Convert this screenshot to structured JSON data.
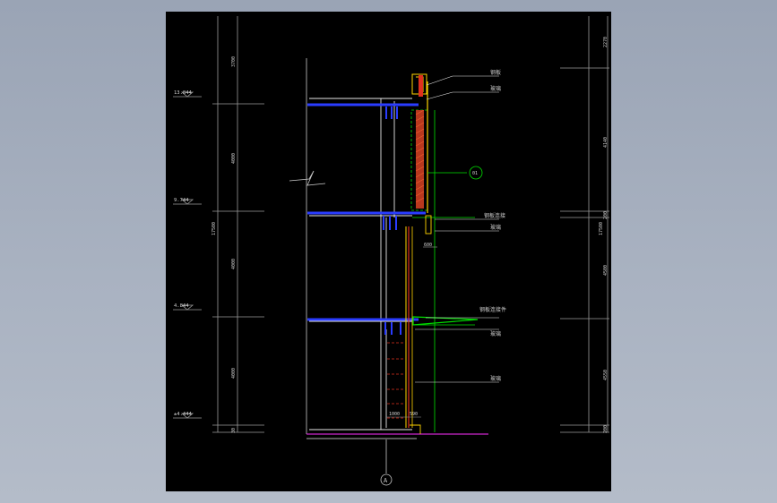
{
  "left_dims": {
    "segments": [
      "3700",
      "4000",
      "4000",
      "4000",
      "30"
    ],
    "levels": [
      "13.844",
      "9.744",
      "4.844",
      "±4.444"
    ]
  },
  "right_dims": {
    "segments": [
      "2270",
      "4140",
      "200",
      "4500",
      "4550",
      "200"
    ],
    "total": "17500"
  },
  "left_total": "17500",
  "dims_bottom": [
    "1000",
    "590"
  ],
  "dim_600": "600",
  "callouts": {
    "top1": "钢板",
    "top2": "玻璃",
    "mid1": "钢板连接",
    "mid2": "玻璃",
    "low1": "钢板连接件",
    "low2": "玻璃",
    "low3": "玻璃"
  },
  "detail_circle": "01",
  "axis_label": "A"
}
